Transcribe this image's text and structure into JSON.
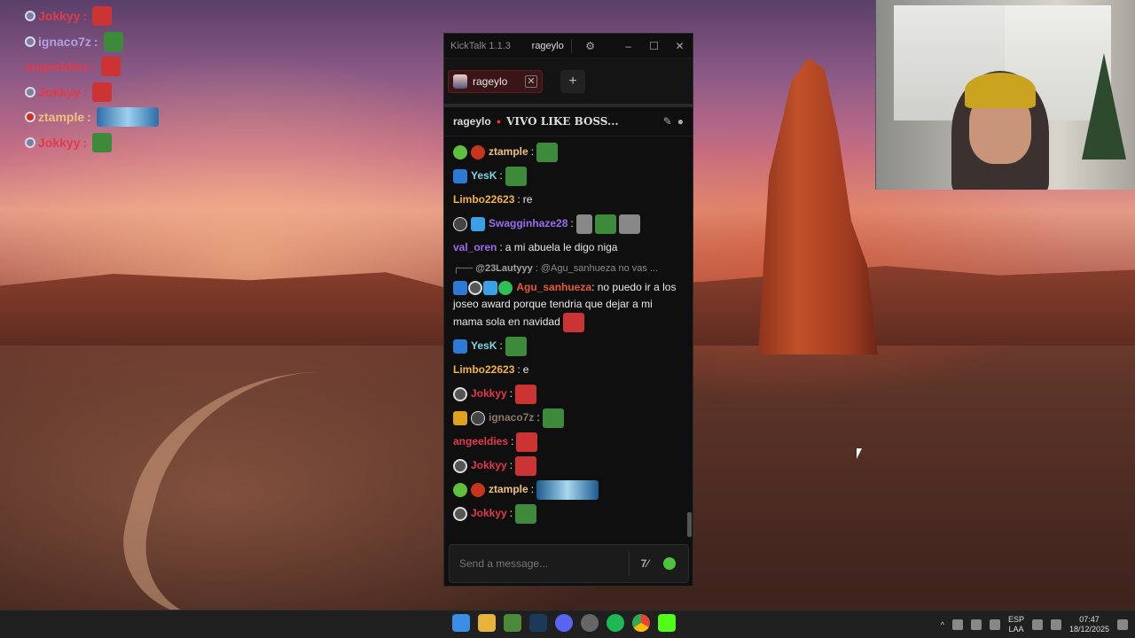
{
  "overlay_chat": [
    {
      "user": "Jokkyy",
      "color": "#e23a4a",
      "sep": ":",
      "emote": "santa"
    },
    {
      "user": "ignaco7z",
      "color": "#b2a0e0",
      "sep": ":",
      "emote": "frog"
    },
    {
      "user": "angeeldies",
      "color": "#e23a4a",
      "sep": ":",
      "emote": "santa"
    },
    {
      "user": "Jokkyy",
      "color": "#e23a4a",
      "sep": ":",
      "emote": "santa"
    },
    {
      "user": "ztample",
      "color": "#f0c080",
      "sep": ":",
      "emote": "wide"
    },
    {
      "user": "Jokkyy",
      "color": "#e23a4a",
      "sep": ":",
      "emote": "frog"
    }
  ],
  "kicktalk": {
    "app_name": "KickTalk 1.1.3",
    "current_user": "rageylo",
    "tab_label": "rageylo",
    "channel_name": "rageylo",
    "stream_title": "VIVO LIKE BOSS...",
    "input_placeholder": "Send a message...",
    "emote_button_label": "7tv",
    "messages": {
      "m1_user": "ztample",
      "m1_sep": ":",
      "m2_user": "YesK",
      "m2_sep": ":",
      "m3_user": "Limbo22623",
      "m3_sep": ":",
      "m3_text": "re",
      "m4_user": "Swagginhaze28",
      "m4_sep": ":",
      "m5_user": "val_oren",
      "m5_sep": ":",
      "m5_text": "a mi abuela le digo niga",
      "m6_reply_user": "@23Lautyyy",
      "m6_reply_text": ": @Agu_sanhueza no vas ...",
      "m6_user": "Agu_sanhueza",
      "m6_sep": ":",
      "m6_text": "no puedo ir a los joseo award porque tendria que dejar a mi mama sola en navidad",
      "m7_user": "YesK",
      "m7_sep": ":",
      "m8_user": "Limbo22623",
      "m8_sep": ":",
      "m8_text": "e",
      "m9_user": "Jokkyy",
      "m9_sep": ":",
      "m10_user": "ignaco7z",
      "m10_sep": ":",
      "m11_user": "angeeldies",
      "m11_sep": ":",
      "m12_user": "Jokkyy",
      "m12_sep": ":",
      "m13_user": "ztample",
      "m13_sep": ":",
      "m14_user": "Jokkyy",
      "m14_sep": ":"
    },
    "colors": {
      "ztample": "#f0c080",
      "YesK": "#7fd6e0",
      "Limbo22623": "#f5b23c",
      "Swagginhaze28": "#9a6cf0",
      "val_oren": "#9a6cf0",
      "Agu_sanhueza": "#e85a3a",
      "Jokkyy": "#e23a4a",
      "ignaco7z": "#8a7a6a",
      "angeeldies": "#e23a4a"
    }
  },
  "taskbar": {
    "language": "ESP",
    "layout": "LAA",
    "time": "07:47",
    "date": "18/12/2025"
  }
}
